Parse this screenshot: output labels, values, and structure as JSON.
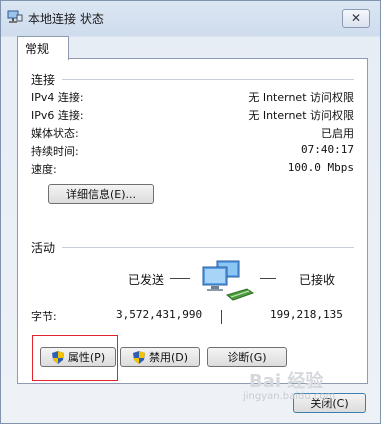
{
  "window": {
    "title": "本地连接 状态",
    "close_label": "✕"
  },
  "tab": {
    "label": "常规"
  },
  "connection": {
    "section": "连接",
    "rows": [
      {
        "label": "IPv4 连接:",
        "value": "无 Internet 访问权限"
      },
      {
        "label": "IPv6 连接:",
        "value": "无 Internet 访问权限"
      },
      {
        "label": "媒体状态:",
        "value": "已启用"
      },
      {
        "label": "持续时间:",
        "value": "07:40:17"
      },
      {
        "label": "速度:",
        "value": "100.0 Mbps"
      }
    ],
    "details_button": "详细信息(E)..."
  },
  "activity": {
    "section": "活动",
    "sent_label": "已发送",
    "received_label": "已接收",
    "bytes_label": "字节:",
    "bytes_sent": "3,572,431,990",
    "bytes_received": "199,218,135"
  },
  "buttons": {
    "properties": "属性(P)",
    "disable": "禁用(D)",
    "diagnose": "诊断(G)",
    "close": "关闭(C)"
  },
  "watermark": {
    "text": "Bai 经验",
    "sub": "jingyan.baidu.com"
  },
  "colors": {
    "highlight": "#e0252a",
    "shield_blue": "#2f5fb3",
    "shield_yellow": "#f2c200"
  }
}
